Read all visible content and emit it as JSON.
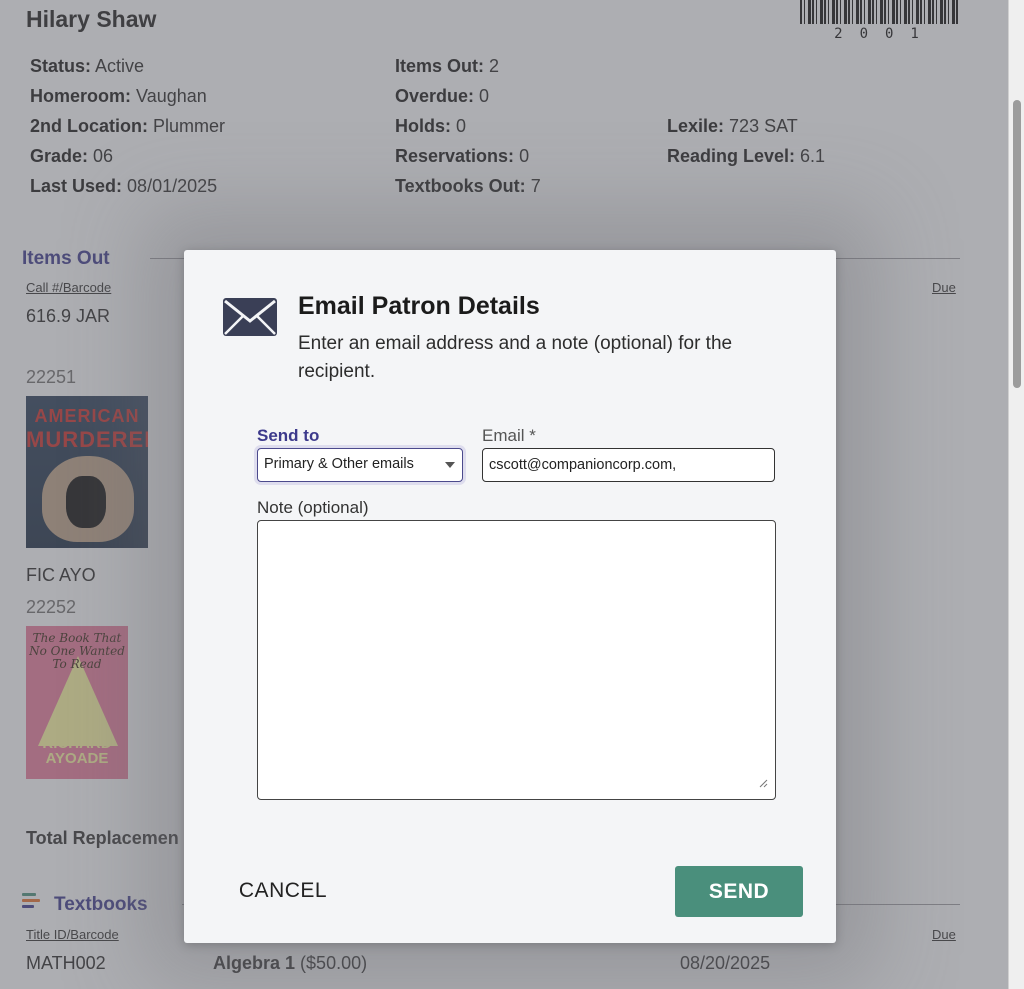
{
  "patron": {
    "name": "Hilary Shaw",
    "barcode": "2001",
    "fields_left": [
      {
        "label": "Status:",
        "value": "Active"
      },
      {
        "label": "Homeroom:",
        "value": "Vaughan"
      },
      {
        "label": "2nd Location:",
        "value": "Plummer"
      },
      {
        "label": "Grade:",
        "value": "06"
      },
      {
        "label": "Last Used:",
        "value": "08/01/2025"
      }
    ],
    "fields_mid": [
      {
        "label": "Items Out:",
        "value": "2"
      },
      {
        "label": "Overdue:",
        "value": "0"
      },
      {
        "label": "Holds:",
        "value": "0"
      },
      {
        "label": "Reservations:",
        "value": "0"
      },
      {
        "label": "Textbooks Out:",
        "value": "7"
      }
    ],
    "fields_right": [
      {
        "label": "Lexile:",
        "value": "723 SAT"
      },
      {
        "label": "Reading Level:",
        "value": "6.1"
      }
    ]
  },
  "items_out": {
    "title": "Items Out",
    "col_call": "Call #/Barcode",
    "col_due": "Due",
    "items": [
      {
        "call": "616.9 JAR",
        "barcode": "22251",
        "cover_line1": "AMERICAN",
        "cover_line2": "MURDERER"
      },
      {
        "call": "FIC AYO",
        "barcode": "22252",
        "cover_text": "The Book That No One Wanted To Read",
        "cover_author": "RICHARD AYOADE"
      }
    ],
    "total_label": "Total Replacemen"
  },
  "textbooks": {
    "title": "Textbooks",
    "col_title": "Title ID/Barcode",
    "col_due": "Due",
    "rows": [
      {
        "id": "MATH002",
        "title": "Algebra 1",
        "price": "($50.00)",
        "due": "08/20/2025"
      }
    ]
  },
  "modal": {
    "title": "Email Patron Details",
    "description": "Enter an email address and a note (optional) for the recipient.",
    "send_to_label": "Send to",
    "send_to_value": "Primary & Other emails",
    "email_label": "Email *",
    "email_value": "cscott@companioncorp.com,",
    "note_label": "Note (optional)",
    "note_value": "",
    "cancel_label": "CANCEL",
    "send_label": "SEND"
  },
  "colors": {
    "accent": "#3d3a8c",
    "send_button": "#4a8f7c"
  },
  "icons": {
    "modal_icon": "envelope-icon",
    "textbooks_icon": "textbooks-stack-icon",
    "select_caret": "caret-down-icon"
  }
}
